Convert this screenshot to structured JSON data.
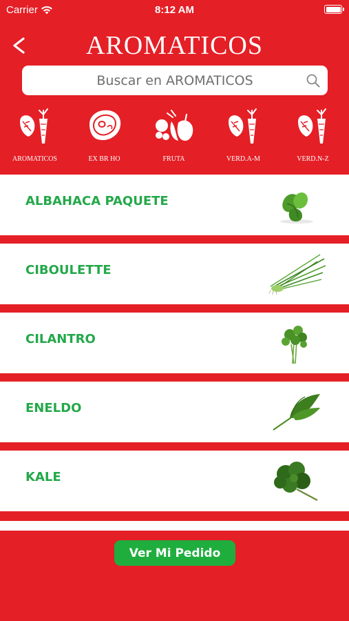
{
  "status_bar": {
    "carrier": "Carrier",
    "time": "8:12 AM"
  },
  "header": {
    "title": "AROMATICOS"
  },
  "search": {
    "placeholder": "Buscar en AROMATICOS"
  },
  "categories": [
    {
      "label": "AROMATICOS",
      "icon": "leaf-carrot-icon"
    },
    {
      "label": "EX BR HO",
      "icon": "steak-icon"
    },
    {
      "label": "FRUTA",
      "icon": "fruit-icon"
    },
    {
      "label": "VERD.A-M",
      "icon": "leaf-carrot-icon"
    },
    {
      "label": "VERD.N-Z",
      "icon": "leaf-carrot-icon"
    }
  ],
  "products": [
    {
      "name": "ALBAHACA PAQUETE",
      "image": "basil-image"
    },
    {
      "name": "CIBOULETTE",
      "image": "chives-image"
    },
    {
      "name": "CILANTRO",
      "image": "cilantro-image"
    },
    {
      "name": "ENELDO",
      "image": "dill-image"
    },
    {
      "name": "KALE",
      "image": "kale-image"
    }
  ],
  "footer": {
    "order_button": "Ver Mi Pedido"
  },
  "colors": {
    "brand_red": "#e41f26",
    "green": "#23a84a",
    "button_green": "#1fae3e"
  }
}
